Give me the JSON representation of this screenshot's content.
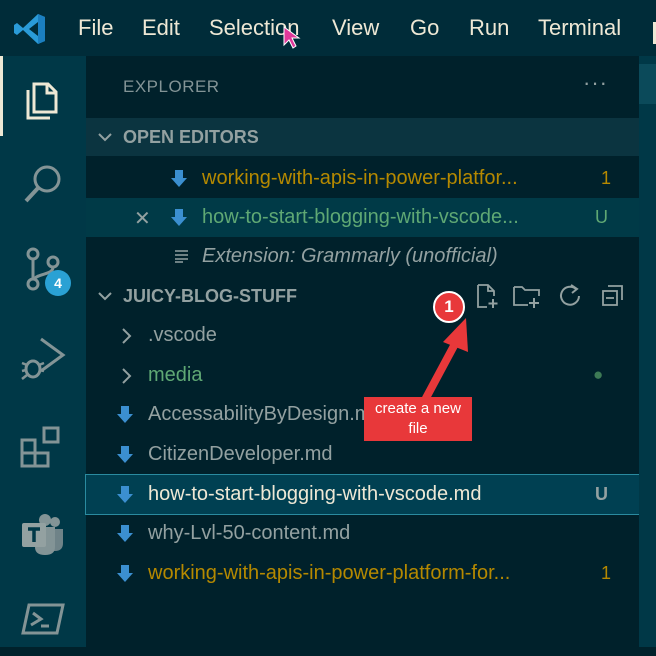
{
  "menu": {
    "items": [
      "File",
      "Edit",
      "Selection",
      "View",
      "Go",
      "Run",
      "Terminal"
    ]
  },
  "activity_bar": {
    "items": [
      {
        "name": "explorer-icon",
        "active": true
      },
      {
        "name": "search-icon"
      },
      {
        "name": "source-control-icon",
        "badge": "4"
      },
      {
        "name": "run-debug-icon"
      },
      {
        "name": "extensions-icon"
      },
      {
        "name": "teams-icon"
      },
      {
        "name": "powershell-icon"
      }
    ]
  },
  "explorer": {
    "title": "EXPLORER",
    "more": "···",
    "open_editors": {
      "label": "OPEN EDITORS",
      "items": [
        {
          "name": "working-with-apis-in-power-platfor...",
          "decoration": "1",
          "color": "#b58900"
        },
        {
          "name": "how-to-start-blogging-with-vscode...",
          "decoration": "U",
          "color": "#5fa874",
          "close": "✕"
        },
        {
          "name": "Extension: Grammarly (unofficial)",
          "decoration": "",
          "color": "#93a1a1"
        }
      ]
    },
    "folder": {
      "label": "JUICY-BLOG-STUFF",
      "items": [
        {
          "name": ".vscode",
          "type": "folder",
          "color": "#93a1a1"
        },
        {
          "name": "media",
          "type": "folder",
          "color": "#5fa874",
          "decoration": "●"
        },
        {
          "name": "AccessabilityByDesign.md",
          "type": "file",
          "color": "#93a1a1"
        },
        {
          "name": "CitizenDeveloper.md",
          "type": "file",
          "color": "#93a1a1"
        },
        {
          "name": "how-to-start-blogging-with-vscode.md",
          "type": "file",
          "color": "#eee8d5",
          "decoration": "U",
          "selected": true
        },
        {
          "name": "why-Lvl-50-content.md",
          "type": "file",
          "color": "#93a1a1"
        },
        {
          "name": "working-with-apis-in-power-platform-for...",
          "type": "file",
          "color": "#b58900",
          "decoration": "1"
        }
      ]
    }
  },
  "annotation": {
    "step": "1",
    "callout": "create a new file"
  },
  "colors": {
    "accent_red": "#e8383a",
    "modified": "#b58900",
    "untracked": "#5fa874",
    "badge": "#2aa1d4"
  }
}
